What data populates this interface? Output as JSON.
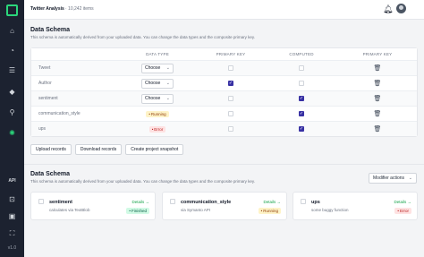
{
  "app": {
    "project_title": "Twitter Analysis",
    "project_count": "· 10,242 items",
    "version": "v1.0"
  },
  "colors": {
    "accent": "#2bd67b",
    "sidebar": "#1c2230",
    "checkbox": "#3730a3"
  },
  "schema": {
    "title": "Data Schema",
    "description": "This schema is automatically derived from your uploaded data. You can change the data types and the composite primary key.",
    "headers": {
      "name": "",
      "data_type": "DATA TYPE",
      "primary_key": "PRIMARY KEY",
      "computed": "COMPUTED",
      "actions": "PRIMARY KEY"
    },
    "rows": [
      {
        "name": "Tweet",
        "type": "Choose",
        "primary_key": false,
        "computed": false
      },
      {
        "name": "Author",
        "type": "Choose",
        "primary_key": true,
        "computed": false
      },
      {
        "name": "sentiment",
        "type": "Choose",
        "primary_key": false,
        "computed": true
      },
      {
        "name": "communication_style",
        "status": "Running",
        "primary_key": false,
        "computed": true
      },
      {
        "name": "ups",
        "status": "Error",
        "primary_key": false,
        "computed": true
      }
    ]
  },
  "buttons": {
    "upload": "Upload records",
    "download": "Download records",
    "snapshot": "Create project snapshot"
  },
  "modifiers": {
    "title": "Data Schema",
    "description": "This schema is automatically derived from your uploaded data. You can change the data types and the composite primary key.",
    "actions_label": "Modifier actions",
    "cards": [
      {
        "title": "sentiment",
        "subtitle": "calculates via TextBlob",
        "link": "Details →",
        "status": "Finished"
      },
      {
        "title": "communication_style",
        "subtitle": "via Symanto API",
        "link": "Details →",
        "status": "Running"
      },
      {
        "title": "ups",
        "subtitle": "some buggy function",
        "link": "Details →",
        "status": "Error"
      }
    ]
  },
  "icons": [
    "logo-icon",
    "home-icon",
    "chart-icon",
    "list-icon",
    "tag-icon",
    "cpu-icon",
    "settings-icon",
    "api-icon",
    "puzzle-icon",
    "grid-icon",
    "expand-icon",
    "bell-icon",
    "trash-icon",
    "chevron-down-icon"
  ]
}
